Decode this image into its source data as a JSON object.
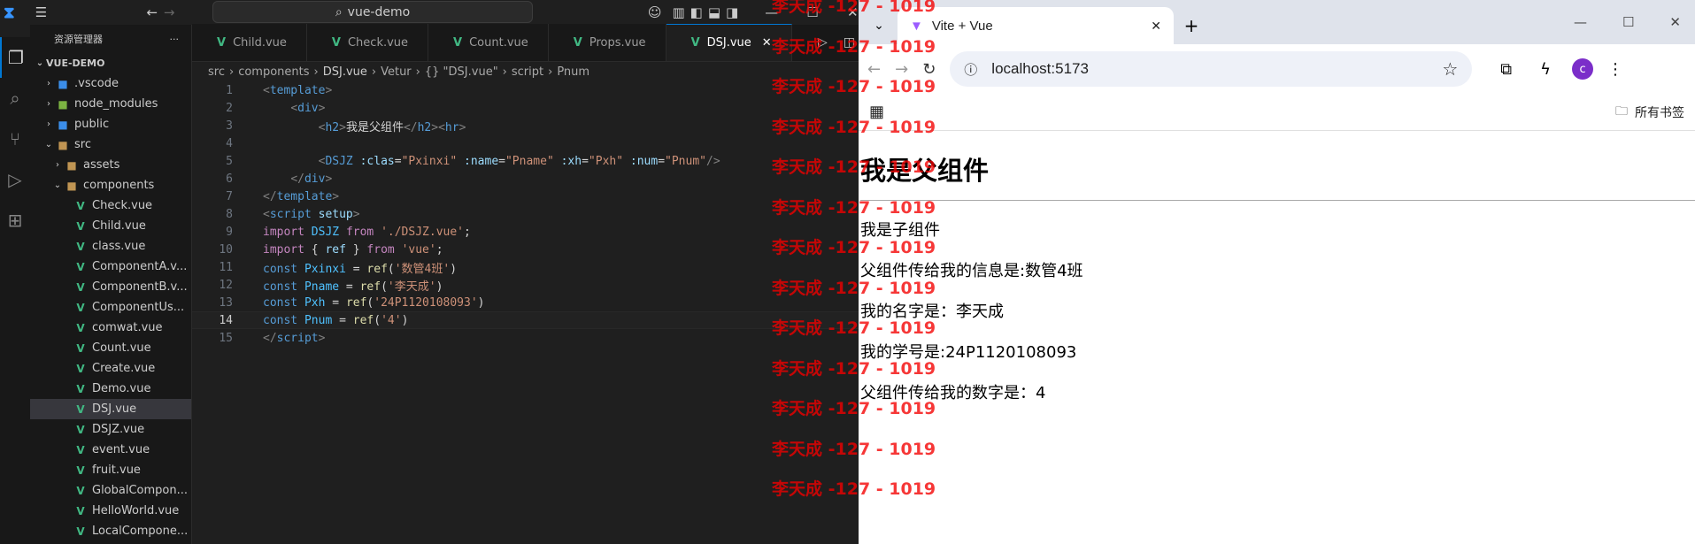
{
  "vscode": {
    "search_text": "vue-demo",
    "sidebar_title": "资源管理器",
    "root": "VUE-DEMO",
    "tree": [
      {
        "label": ".vscode",
        "kind": "folder",
        "indent": 1,
        "open": false
      },
      {
        "label": "node_modules",
        "kind": "folder",
        "indent": 1,
        "open": false
      },
      {
        "label": "public",
        "kind": "folder",
        "indent": 1,
        "open": false
      },
      {
        "label": "src",
        "kind": "folder",
        "indent": 1,
        "open": true
      },
      {
        "label": "assets",
        "kind": "folder",
        "indent": 2,
        "open": false
      },
      {
        "label": "components",
        "kind": "folder",
        "indent": 2,
        "open": true
      },
      {
        "label": "Check.vue",
        "kind": "vue",
        "indent": 3
      },
      {
        "label": "Child.vue",
        "kind": "vue",
        "indent": 3
      },
      {
        "label": "class.vue",
        "kind": "vue",
        "indent": 3
      },
      {
        "label": "ComponentA.v...",
        "kind": "vue",
        "indent": 3
      },
      {
        "label": "ComponentB.v...",
        "kind": "vue",
        "indent": 3
      },
      {
        "label": "ComponentUs...",
        "kind": "vue",
        "indent": 3
      },
      {
        "label": "comwat.vue",
        "kind": "vue",
        "indent": 3
      },
      {
        "label": "Count.vue",
        "kind": "vue",
        "indent": 3
      },
      {
        "label": "Create.vue",
        "kind": "vue",
        "indent": 3
      },
      {
        "label": "Demo.vue",
        "kind": "vue",
        "indent": 3
      },
      {
        "label": "DSJ.vue",
        "kind": "vue",
        "indent": 3,
        "selected": true
      },
      {
        "label": "DSJZ.vue",
        "kind": "vue",
        "indent": 3
      },
      {
        "label": "event.vue",
        "kind": "vue",
        "indent": 3
      },
      {
        "label": "fruit.vue",
        "kind": "vue",
        "indent": 3
      },
      {
        "label": "GlobalCompon...",
        "kind": "vue",
        "indent": 3
      },
      {
        "label": "HelloWorld.vue",
        "kind": "vue",
        "indent": 3
      },
      {
        "label": "LocalCompone...",
        "kind": "vue",
        "indent": 3
      }
    ],
    "tabs": [
      {
        "label": "Child.vue",
        "active": false
      },
      {
        "label": "Check.vue",
        "active": false
      },
      {
        "label": "Count.vue",
        "active": false
      },
      {
        "label": "Props.vue",
        "active": false
      },
      {
        "label": "DSJ.vue",
        "active": true
      }
    ],
    "breadcrumb": [
      "src",
      "components",
      "DSJ.vue",
      "Vetur",
      "{} \"DSJ.vue\"",
      "script",
      "Pnum"
    ],
    "current_line": 14,
    "code": [
      [
        [
          "tg",
          "<"
        ],
        [
          "tn",
          "template"
        ],
        [
          "tg",
          ">"
        ]
      ],
      [
        [
          "tx",
          "    "
        ],
        [
          "tg",
          "<"
        ],
        [
          "tn",
          "div"
        ],
        [
          "tg",
          ">"
        ]
      ],
      [
        [
          "tx",
          "        "
        ],
        [
          "tg",
          "<"
        ],
        [
          "tn",
          "h2"
        ],
        [
          "tg",
          ">"
        ],
        [
          "tx",
          "我是父组件"
        ],
        [
          "tg",
          "</"
        ],
        [
          "tn",
          "h2"
        ],
        [
          "tg",
          "><"
        ],
        [
          "tn",
          "hr"
        ],
        [
          "tg",
          ">"
        ]
      ],
      [
        [
          "tx",
          ""
        ]
      ],
      [
        [
          "tx",
          "        "
        ],
        [
          "tg",
          "<"
        ],
        [
          "tn",
          "DSJZ"
        ],
        [
          "tx",
          " "
        ],
        [
          "at",
          ":clas"
        ],
        [
          "tx",
          "="
        ],
        [
          "st",
          "\"Pxinxi\""
        ],
        [
          "tx",
          " "
        ],
        [
          "at",
          ":name"
        ],
        [
          "tx",
          "="
        ],
        [
          "st",
          "\"Pname\""
        ],
        [
          "tx",
          " "
        ],
        [
          "at",
          ":xh"
        ],
        [
          "tx",
          "="
        ],
        [
          "st",
          "\"Pxh\""
        ],
        [
          "tx",
          " "
        ],
        [
          "at",
          ":num"
        ],
        [
          "tx",
          "="
        ],
        [
          "st",
          "\"Pnum\""
        ],
        [
          "tg",
          "/>"
        ]
      ],
      [
        [
          "tx",
          "    "
        ],
        [
          "tg",
          "</"
        ],
        [
          "tn",
          "div"
        ],
        [
          "tg",
          ">"
        ]
      ],
      [
        [
          "tg",
          "</"
        ],
        [
          "tn",
          "template"
        ],
        [
          "tg",
          ">"
        ]
      ],
      [
        [
          "tg",
          "<"
        ],
        [
          "tn",
          "script"
        ],
        [
          "tx",
          " "
        ],
        [
          "at",
          "setup"
        ],
        [
          "tg",
          ">"
        ]
      ],
      [
        [
          "kw",
          "import"
        ],
        [
          "tx",
          " "
        ],
        [
          "vr",
          "DSJZ"
        ],
        [
          "tx",
          " "
        ],
        [
          "kw",
          "from"
        ],
        [
          "tx",
          " "
        ],
        [
          "st",
          "'./DSJZ.vue'"
        ],
        [
          "tx",
          ";"
        ]
      ],
      [
        [
          "kw",
          "import"
        ],
        [
          "tx",
          " { "
        ],
        [
          "at",
          "ref"
        ],
        [
          "tx",
          " } "
        ],
        [
          "kw",
          "from"
        ],
        [
          "tx",
          " "
        ],
        [
          "st",
          "'vue'"
        ],
        [
          "tx",
          ";"
        ]
      ],
      [
        [
          "tn",
          "const"
        ],
        [
          "tx",
          " "
        ],
        [
          "vr",
          "Pxinxi"
        ],
        [
          "tx",
          " = "
        ],
        [
          "fn",
          "ref"
        ],
        [
          "tx",
          "("
        ],
        [
          "st",
          "'数管4班'"
        ],
        [
          "tx",
          ")"
        ]
      ],
      [
        [
          "tn",
          "const"
        ],
        [
          "tx",
          " "
        ],
        [
          "vr",
          "Pname"
        ],
        [
          "tx",
          " = "
        ],
        [
          "fn",
          "ref"
        ],
        [
          "tx",
          "("
        ],
        [
          "st",
          "'李天成'"
        ],
        [
          "tx",
          ")"
        ]
      ],
      [
        [
          "tn",
          "const"
        ],
        [
          "tx",
          " "
        ],
        [
          "vr",
          "Pxh"
        ],
        [
          "tx",
          " = "
        ],
        [
          "fn",
          "ref"
        ],
        [
          "tx",
          "("
        ],
        [
          "st",
          "'24P1120108093'"
        ],
        [
          "tx",
          ")"
        ]
      ],
      [
        [
          "tn",
          "const"
        ],
        [
          "tx",
          " "
        ],
        [
          "vr",
          "Pnum"
        ],
        [
          "tx",
          " = "
        ],
        [
          "fn",
          "ref"
        ],
        [
          "tx",
          "("
        ],
        [
          "st",
          "'4'"
        ],
        [
          "tx",
          ")"
        ]
      ],
      [
        [
          "tg",
          "</"
        ],
        [
          "tn",
          "script"
        ],
        [
          "tg",
          ">"
        ]
      ]
    ]
  },
  "browser": {
    "tab_title": "Vite + Vue",
    "url": "localhost:5173",
    "profile": "c",
    "bookmarks_label": "所有书签",
    "page": {
      "heading": "我是父组件",
      "lines": [
        "我是子组件",
        "父组件传给我的信息是:数管4班",
        "我的名字是：李天成",
        "我的学号是:24P1120108093",
        "父组件传给我的数字是：4"
      ]
    }
  },
  "watermark": "李天成 -127 - 1019",
  "colors": {
    "vue_green": "#41b883",
    "watermark_red": "#f40000",
    "accent_blue": "#0078d4"
  }
}
